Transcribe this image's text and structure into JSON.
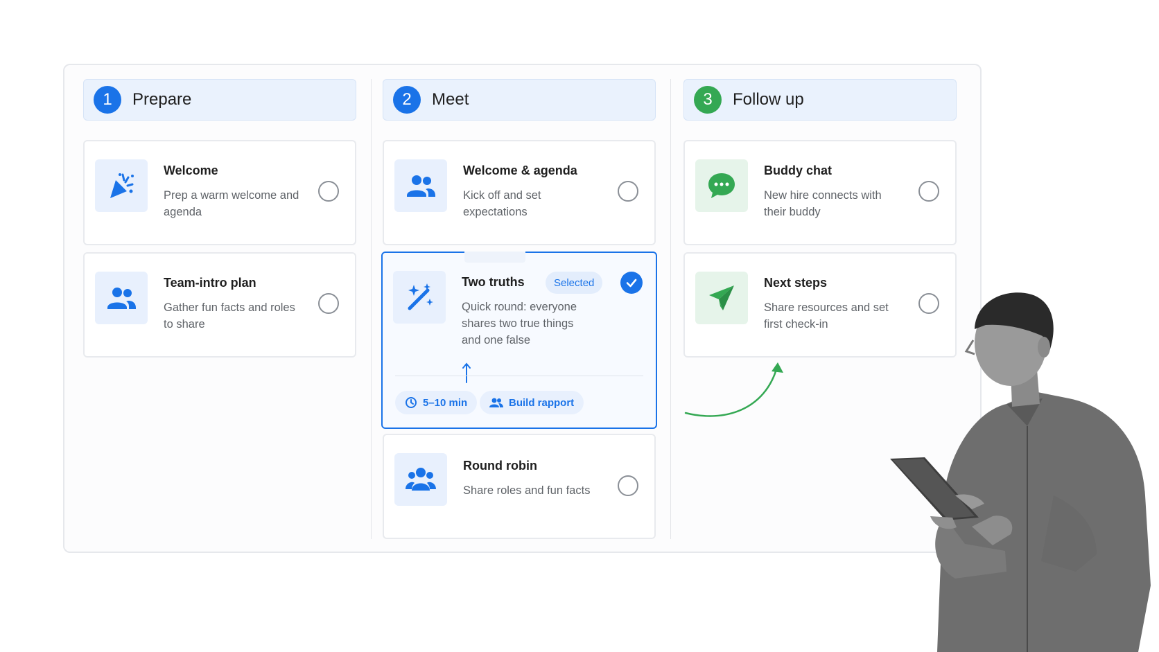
{
  "columns": [
    {
      "number": "1",
      "title": "Prepare",
      "number_color": "#1a73e8",
      "cards": [
        {
          "title": "Welcome",
          "description": "Prep a warm welcome and agenda",
          "icon": "party-popper-icon"
        },
        {
          "title": "Team-intro plan",
          "description": "Gather fun facts and roles to share",
          "icon": "people-icon"
        }
      ]
    },
    {
      "number": "2",
      "title": "Meet",
      "number_color": "#1a73e8",
      "cards": [
        {
          "title": "Welcome & agenda",
          "description": "Kick off and set expectations",
          "icon": "people-icon"
        },
        {
          "title": "Two truths",
          "description": "Quick round: everyone shares two true things and one false",
          "icon": "magic-wand-icon",
          "selected": true,
          "badge": "Selected",
          "chips": [
            "5–10 min",
            "Build rapport"
          ]
        },
        {
          "title": "Round robin",
          "description": "Share roles and fun facts",
          "icon": "group-icon"
        }
      ]
    },
    {
      "number": "3",
      "title": "Follow up",
      "number_color": "#34a853",
      "cards": [
        {
          "title": "Buddy chat",
          "description": "New hire connects with their buddy",
          "icon": "chat-bubble-icon"
        },
        {
          "title": "Next steps",
          "description": "Share resources and set first check-in",
          "icon": "paper-plane-icon"
        }
      ]
    }
  ],
  "colors": {
    "accent": "#1a73e8",
    "success": "#34a853",
    "header_bg": "#eaf2fd"
  }
}
